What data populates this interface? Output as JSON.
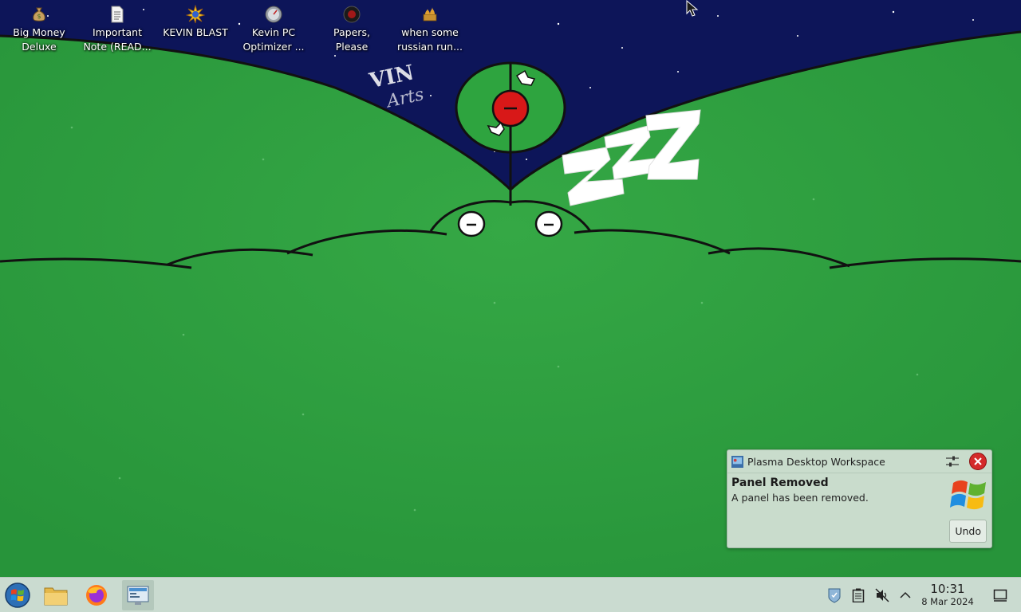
{
  "desktop": {
    "icons": [
      {
        "name": "big-money-deluxe",
        "line1": "Big Money",
        "line2": "Deluxe",
        "icon": "money-bag-icon"
      },
      {
        "name": "important-note",
        "line1": "Important",
        "line2": "Note (READ...",
        "icon": "text-file-icon"
      },
      {
        "name": "kevin-blast",
        "line1": "KEVIN BLAST",
        "line2": "",
        "icon": "starburst-icon"
      },
      {
        "name": "kevin-pc-optimizer",
        "line1": "Kevin PC",
        "line2": "Optimizer ...",
        "icon": "gauge-icon"
      },
      {
        "name": "papers-please",
        "line1": "Papers,",
        "line2": "Please",
        "icon": "red-seal-icon"
      },
      {
        "name": "russian-run",
        "line1": "when some",
        "line2": "russian run...",
        "icon": "kremlin-icon"
      }
    ]
  },
  "notification": {
    "app": "Plasma Desktop Workspace",
    "title": "Panel Removed",
    "body": "A panel has been removed.",
    "undo_label": "Undo"
  },
  "taskbar": {
    "apps": [
      "start-menu",
      "file-manager",
      "firefox",
      "system-settings"
    ],
    "clock_time": "10:31",
    "clock_date": "8 Mar 2024"
  },
  "colors": {
    "wallpaper_green": "#2a9a3a",
    "sky": "#0d1559",
    "taskbar": "#cadbd0",
    "notification_bg": "#c9dccc"
  }
}
